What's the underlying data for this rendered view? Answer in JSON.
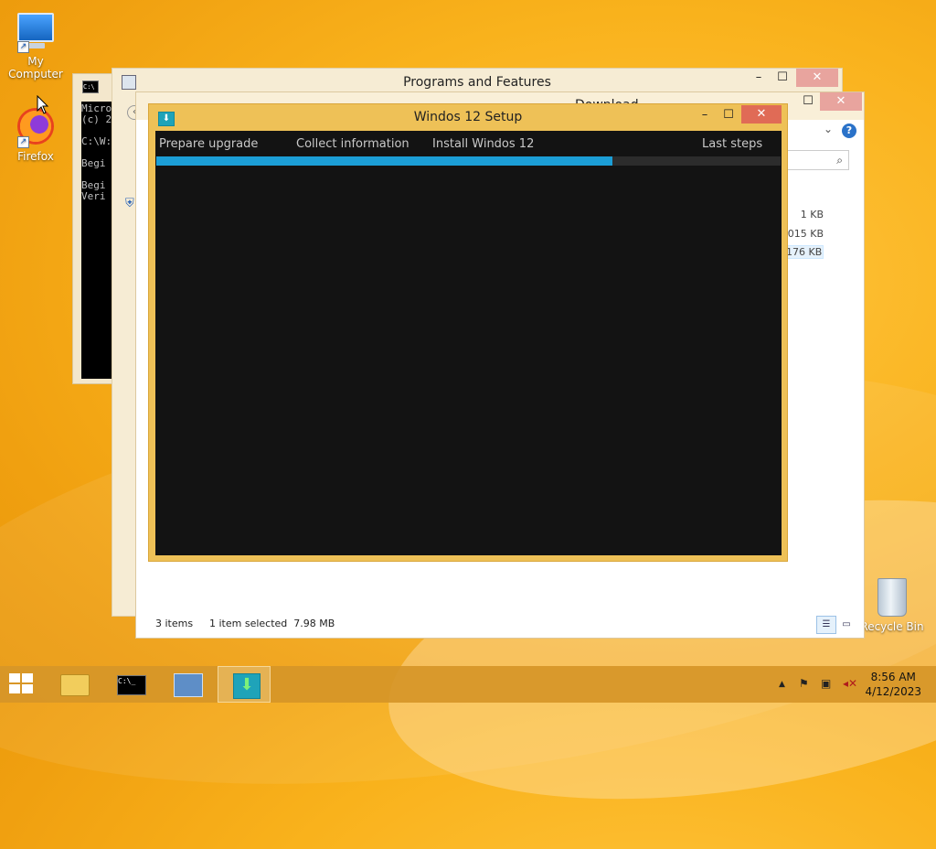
{
  "desktop": {
    "icons": [
      {
        "label": "My Computer"
      },
      {
        "label": "Firefox"
      },
      {
        "label": "Recycle Bin"
      }
    ]
  },
  "cmd_window": {
    "lines": [
      "Micro",
      "(c) 2",
      "",
      "C:\\W:",
      "",
      "Begi",
      "",
      "Begi",
      "Veri"
    ]
  },
  "programs_features": {
    "title": "Programs and Features"
  },
  "downloads_window": {
    "title_partial": "Download",
    "sizes": [
      "1 KB",
      "015 KB",
      "176 KB"
    ],
    "status_items": "3 items",
    "status_selected": "1 item selected  7.98 MB"
  },
  "setup_window": {
    "title": "Windos 12 Setup",
    "steps": [
      "Prepare upgrade",
      "Collect information",
      "Install Windos 12",
      "Last steps"
    ],
    "progress_percent": 73
  },
  "taskbar": {
    "time": "8:56 AM",
    "date": "4/12/2023",
    "tray_chevron": "▲"
  },
  "colors": {
    "setup_frame": "#eec157",
    "progress": "#1c9ed6",
    "close_button": "#c7504a"
  }
}
